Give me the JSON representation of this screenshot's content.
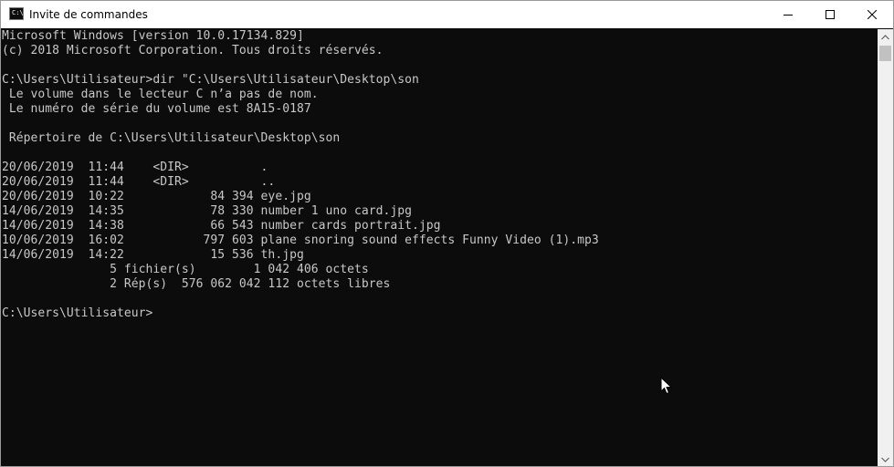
{
  "window": {
    "title": "Invite de commandes",
    "icon": "cmd-console-icon",
    "icon_text": "C:\\."
  },
  "controls": {
    "minimize": "minimize-icon",
    "maximize": "maximize-icon",
    "close": "close-icon"
  },
  "console": {
    "lines": [
      "Microsoft Windows [version 10.0.17134.829]",
      "(c) 2018 Microsoft Corporation. Tous droits réservés.",
      "",
      "C:\\Users\\Utilisateur>dir \"C:\\Users\\Utilisateur\\Desktop\\son",
      " Le volume dans le lecteur C n’a pas de nom.",
      " Le numéro de série du volume est 8A15-0187",
      "",
      " Répertoire de C:\\Users\\Utilisateur\\Desktop\\son",
      "",
      "20/06/2019  11:44    <DIR>          .",
      "20/06/2019  11:44    <DIR>          ..",
      "20/06/2019  10:22            84 394 eye.jpg",
      "14/06/2019  14:35            78 330 number 1 uno card.jpg",
      "14/06/2019  14:38            66 543 number cards portrait.jpg",
      "10/06/2019  16:02           797 603 plane snoring sound effects Funny Video (1).mp3",
      "14/06/2019  14:22            15 536 th.jpg",
      "               5 fichier(s)        1 042 406 octets",
      "               2 Rép(s)  576 062 042 112 octets libres",
      "",
      "C:\\Users\\Utilisateur>"
    ]
  },
  "colors": {
    "console_bg": "#0c0c0c",
    "console_fg": "#c8c8c8",
    "titlebar_bg": "#ffffff",
    "scrollbar_bg": "#f0f0f0",
    "scrollbar_thumb": "#c1c1c1"
  }
}
